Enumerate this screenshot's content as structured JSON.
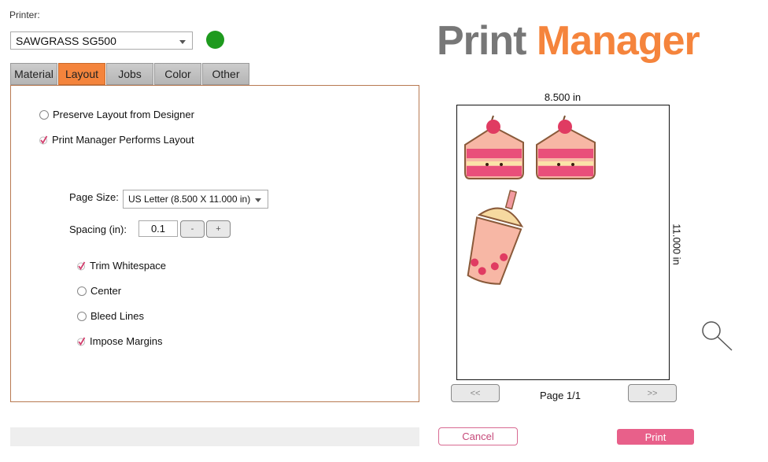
{
  "printer": {
    "label": "Printer:",
    "selected": "SAWGRASS SG500",
    "status_color": "#1e9a1e"
  },
  "tabs": [
    {
      "label": "Material"
    },
    {
      "label": "Layout",
      "active": true
    },
    {
      "label": "Jobs"
    },
    {
      "label": "Color"
    },
    {
      "label": "Other"
    }
  ],
  "layout": {
    "preserve_label": "Preserve Layout from Designer",
    "preserve_checked": false,
    "performs_label": "Print Manager Performs Layout",
    "performs_checked": true,
    "page_size_label": "Page Size:",
    "page_size_value": "US Letter (8.500 X 11.000 in)",
    "spacing_label": "Spacing (in):",
    "spacing_value": "0.1",
    "minus": "-",
    "plus": "+",
    "options": [
      {
        "label": "Trim Whitespace",
        "checked": true
      },
      {
        "label": "Center",
        "checked": false
      },
      {
        "label": "Bleed Lines",
        "checked": false
      },
      {
        "label": "Impose Margins",
        "checked": true
      }
    ]
  },
  "logo": {
    "word1": "Print",
    "word2": "Manager",
    "color1": "#777777",
    "color2": "#f5843c"
  },
  "preview": {
    "width_label": "8.500 in",
    "height_label": "11.000 in",
    "prev": "<<",
    "next": ">>",
    "page": "Page 1/1"
  },
  "actions": {
    "cancel": "Cancel",
    "print": "Print",
    "accent": "#e8608a"
  }
}
